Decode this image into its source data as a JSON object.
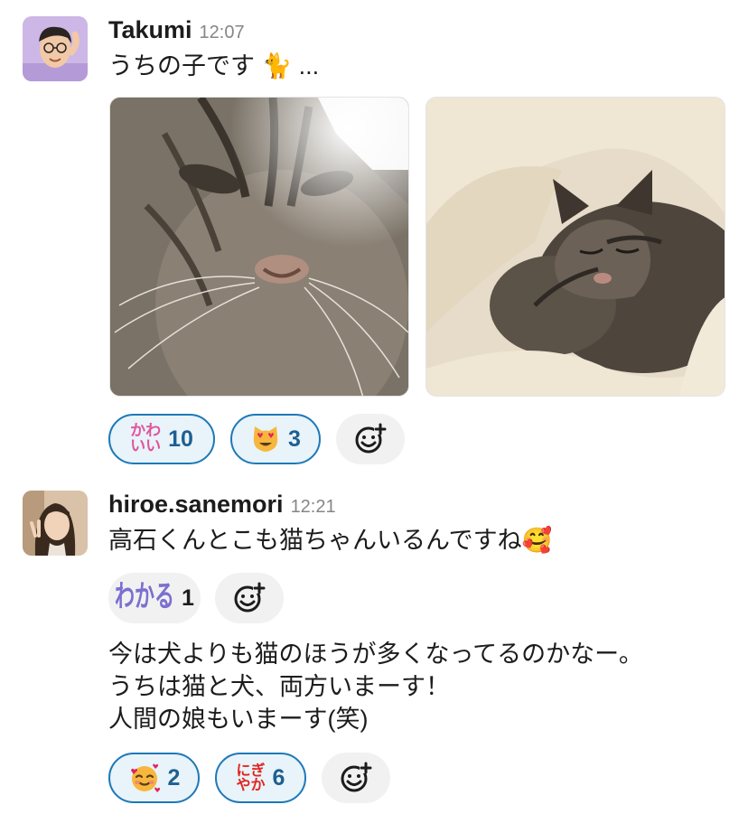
{
  "messages": [
    {
      "author": "Takumi",
      "time": "12:07",
      "text": "うちの子です 🐈 ...",
      "reactions": [
        {
          "emoji": "かわいい-icon",
          "emoji_text_1": "かわ",
          "emoji_text_2": "いい",
          "count": "10",
          "active": true
        },
        {
          "emoji": "heart-eyes-cat-icon",
          "count": "3",
          "active": true
        }
      ]
    },
    {
      "author": "hiroe.sanemori",
      "time": "12:21",
      "text": "高石くんとこも猫ちゃんいるんですね🥰",
      "reactions": [
        {
          "emoji": "わかる-icon",
          "emoji_text": "わかる",
          "count": "1",
          "active": false
        }
      ]
    },
    {
      "text_lines": [
        "今は犬よりも猫のほうが多くなってるのかなー。",
        "うちは猫と犬、両方いまーす！",
        "人間の娘もいまーす(笑)"
      ],
      "reactions": [
        {
          "emoji": "smiling-face-with-hearts-icon",
          "count": "2",
          "active": true
        },
        {
          "emoji": "にぎやか-icon",
          "emoji_text_1": "にぎ",
          "emoji_text_2": "やか",
          "count": "6",
          "active": true
        }
      ]
    }
  ],
  "colors": {
    "active_border": "#1d79b8",
    "active_bg": "#e8f3fa",
    "timestamp": "#868686",
    "kawaii_pink": "#e0559c",
    "wakaru_purple": "#7b6fd0",
    "nigiyaka_red": "#e0241d"
  }
}
